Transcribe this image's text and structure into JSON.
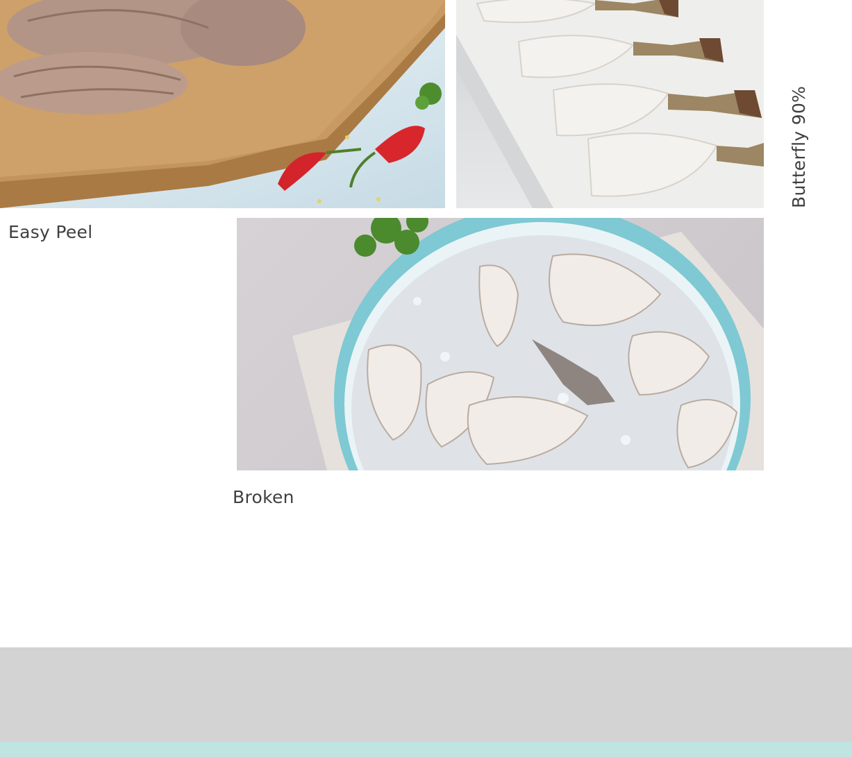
{
  "gallery": {
    "items": [
      {
        "caption": "Easy Peel",
        "image_icon": "shrimp-cutting-board-photo"
      },
      {
        "caption": "Butterfly 90%",
        "image_icon": "butterfly-shrimp-marble-photo"
      },
      {
        "caption": "Broken",
        "image_icon": "broken-shrimp-salt-bowl-photo"
      }
    ]
  },
  "colors": {
    "caption_text": "#3f3f3f",
    "footer_band": "#d3d3d3",
    "footer_accent": "#bfe4e2"
  }
}
